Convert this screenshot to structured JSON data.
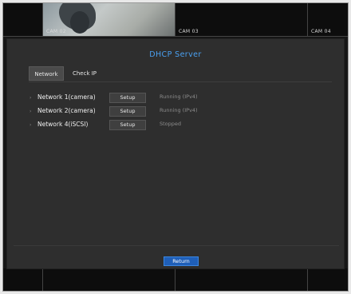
{
  "cameras": [
    {
      "label": ""
    },
    {
      "label": "CAM 02"
    },
    {
      "label": "CAM 03"
    },
    {
      "label": "CAM 04"
    }
  ],
  "dialog": {
    "title": "DHCP Server",
    "tabs": [
      {
        "label": "Network",
        "active": true
      },
      {
        "label": "Check IP",
        "active": false
      }
    ],
    "rows": [
      {
        "name": "Network 1(camera)",
        "button": "Setup",
        "status": "Running (IPv4)"
      },
      {
        "name": "Network 2(camera)",
        "button": "Setup",
        "status": "Running (IPv4)"
      },
      {
        "name": "Network 4(iSCSI)",
        "button": "Setup",
        "status": "Stopped"
      }
    ],
    "return_label": "Return"
  },
  "colors": {
    "title": "#4aa0f0",
    "return_button": "#1f5fb8",
    "panel": "#2e2e2e"
  }
}
